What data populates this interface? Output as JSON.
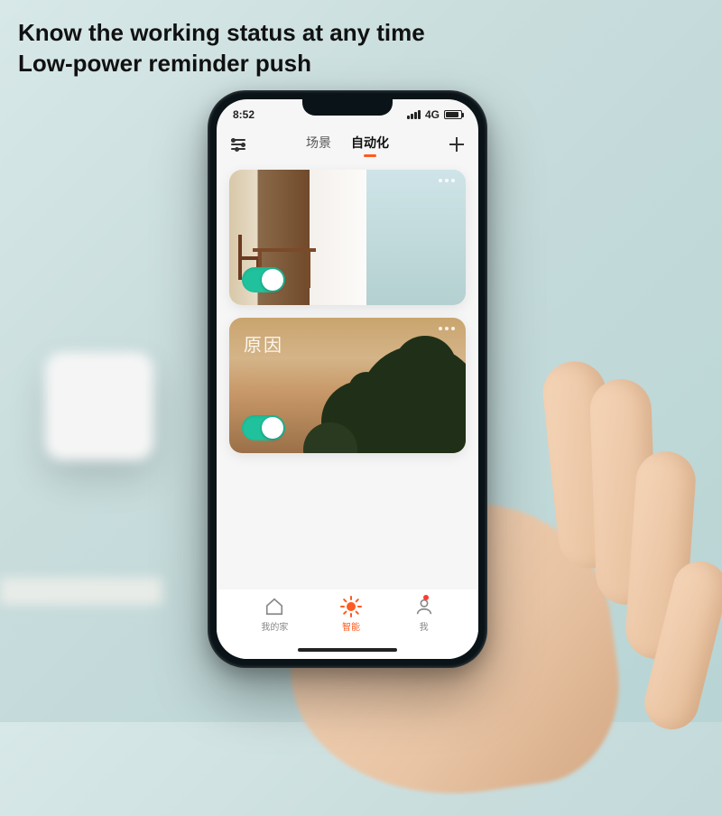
{
  "headline": {
    "line1": "Know the working status at any time",
    "line2": "Low-power reminder push"
  },
  "statusbar": {
    "time": "8:52",
    "network": "4G"
  },
  "header": {
    "tabs": [
      {
        "label": "场景",
        "active": false
      },
      {
        "label": "自动化",
        "active": true
      }
    ]
  },
  "cards": [
    {
      "id": "scene-dining",
      "toggle_on": true
    },
    {
      "id": "scene-sunset",
      "label": "原因",
      "toggle_on": true
    }
  ],
  "bottom_nav": {
    "items": [
      {
        "id": "home",
        "label": "我的家",
        "active": false,
        "badge": false
      },
      {
        "id": "smart",
        "label": "智能",
        "active": true,
        "badge": false
      },
      {
        "id": "profile",
        "label": "我",
        "active": false,
        "badge": true
      }
    ]
  },
  "colors": {
    "accent": "#ff5a1f",
    "toggle_on": "#1fc29c"
  }
}
